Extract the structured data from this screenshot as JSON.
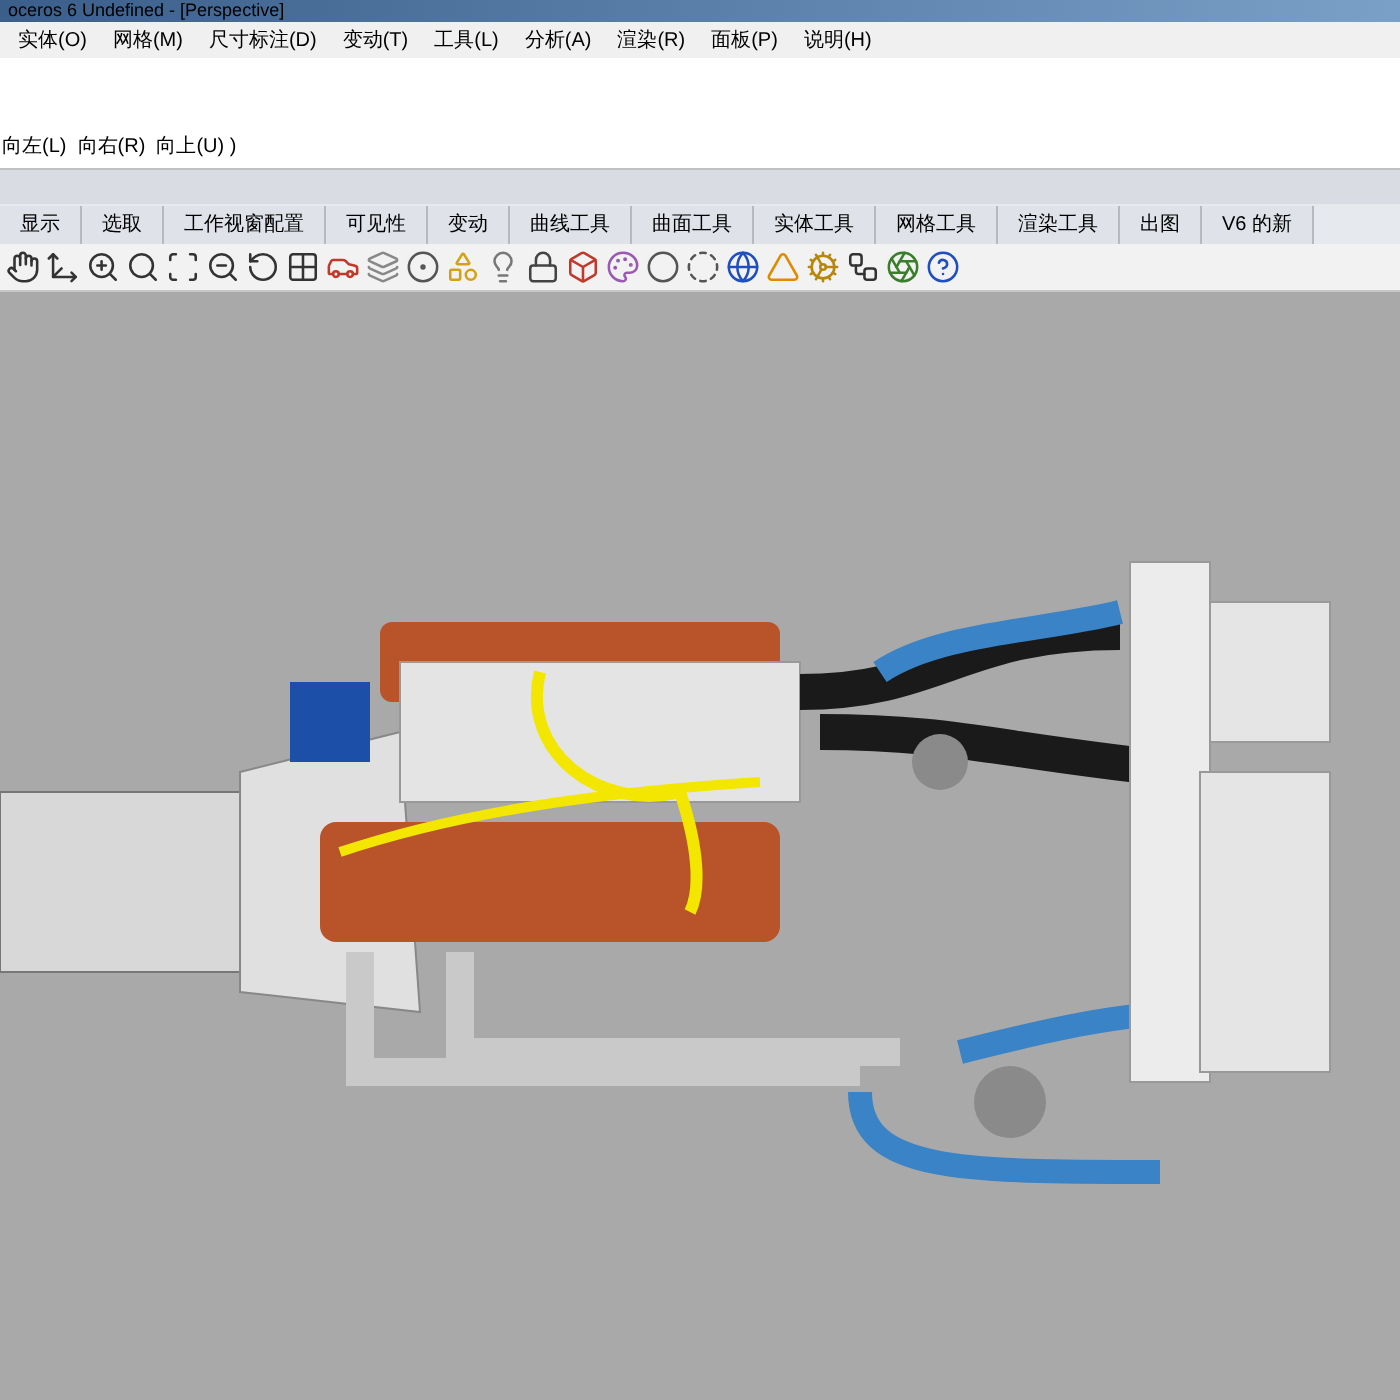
{
  "window": {
    "title": "oceros 6 Undefined - [Perspective]"
  },
  "menu": [
    "实体(O)",
    "网格(M)",
    "尺寸标注(D)",
    "变动(T)",
    "工具(L)",
    "分析(A)",
    "渲染(R)",
    "面板(P)",
    "说明(H)"
  ],
  "command_line": "向左(L)  向右(R)  向上(U) )",
  "tabs": [
    {
      "label": "显示",
      "selected": false
    },
    {
      "label": "选取",
      "selected": false
    },
    {
      "label": "工作视窗配置",
      "selected": false
    },
    {
      "label": "可见性",
      "selected": false
    },
    {
      "label": "变动",
      "selected": false
    },
    {
      "label": "曲线工具",
      "selected": false
    },
    {
      "label": "曲面工具",
      "selected": false
    },
    {
      "label": "实体工具",
      "selected": false
    },
    {
      "label": "网格工具",
      "selected": false
    },
    {
      "label": "渲染工具",
      "selected": false
    },
    {
      "label": "出图",
      "selected": false
    },
    {
      "label": "V6 的新",
      "selected": false
    }
  ]
}
